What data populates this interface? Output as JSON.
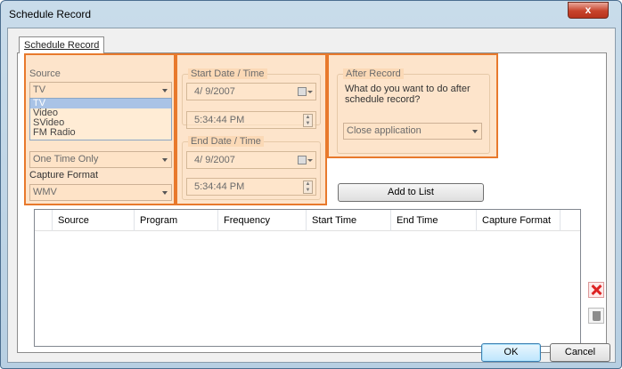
{
  "window": {
    "title": "Schedule Record",
    "close_glyph": "x"
  },
  "tabs": [
    {
      "label": "Schedule Record"
    }
  ],
  "source": {
    "label": "Source",
    "selected": "TV",
    "options": [
      "TV",
      "Video",
      "SVideo",
      "FM Radio"
    ]
  },
  "frequency": {
    "selected": "One Time Only"
  },
  "capture_format": {
    "label": "Capture Format",
    "selected": "WMV"
  },
  "start": {
    "label": "Start Date / Time",
    "date": "4/ 9/2007",
    "time": "5:34:44 PM"
  },
  "end": {
    "label": "End Date / Time",
    "date": "4/ 9/2007",
    "time": "5:34:44 PM"
  },
  "after_record": {
    "label": "After Record",
    "question": "What do you want to do after schedule record?",
    "selected": "Close application"
  },
  "add_to_list_label": "Add to List",
  "table": {
    "columns": [
      "Source",
      "Program",
      "Frequency",
      "Start Time",
      "End Time",
      "Capture Format"
    ]
  },
  "side_icons": [
    "delete-icon",
    "trash-icon"
  ],
  "footer": {
    "ok_label": "OK",
    "cancel_label": "Cancel"
  },
  "colors": {
    "highlight": "#e8792c",
    "close_button": "#c7432b"
  }
}
